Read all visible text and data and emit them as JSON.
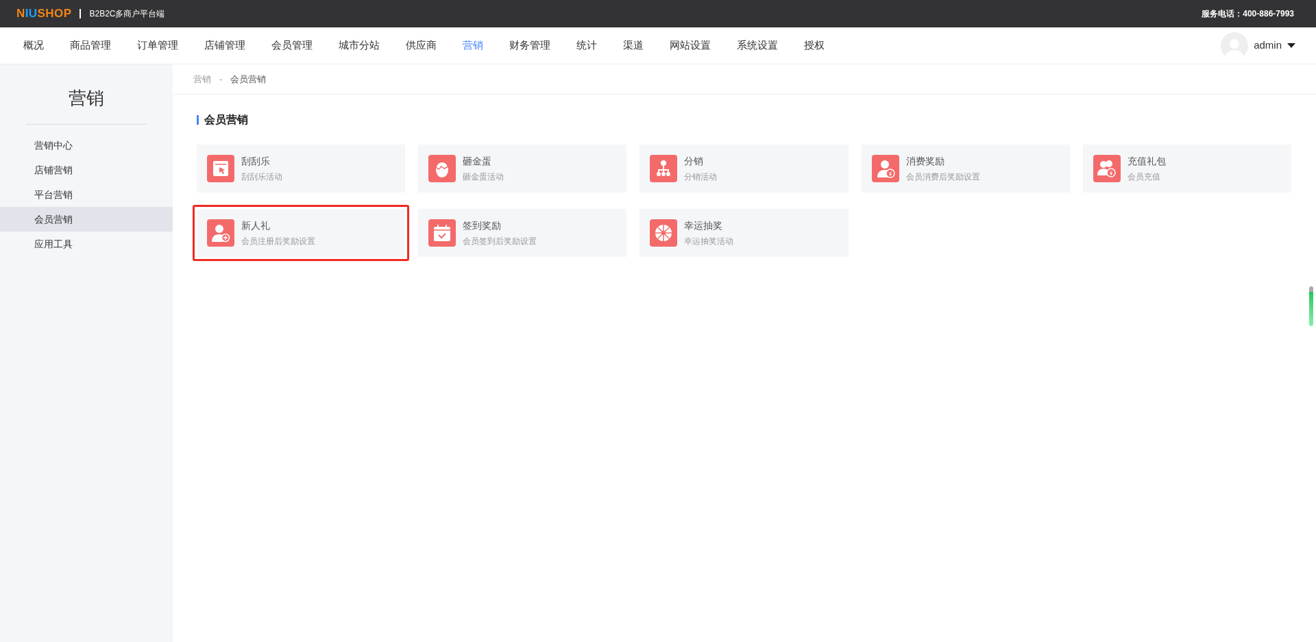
{
  "topbar": {
    "logo": [
      {
        "text": "N",
        "color": "#f08519"
      },
      {
        "text": "IU",
        "color": "#1e9fff"
      },
      {
        "text": "SHOP",
        "color": "#f08519"
      }
    ],
    "subtitle": "B2B2C多商户平台端",
    "service": "服务电话：400-886-7993"
  },
  "nav": {
    "items": [
      {
        "label": "概况",
        "selected": false
      },
      {
        "label": "商品管理",
        "selected": false
      },
      {
        "label": "订单管理",
        "selected": false
      },
      {
        "label": "店铺管理",
        "selected": false
      },
      {
        "label": "会员管理",
        "selected": false
      },
      {
        "label": "城市分站",
        "selected": false
      },
      {
        "label": "供应商",
        "selected": false
      },
      {
        "label": "营销",
        "selected": true
      },
      {
        "label": "财务管理",
        "selected": false
      },
      {
        "label": "统计",
        "selected": false
      },
      {
        "label": "渠道",
        "selected": false
      },
      {
        "label": "网站设置",
        "selected": false
      },
      {
        "label": "系统设置",
        "selected": false
      },
      {
        "label": "授权",
        "selected": false
      }
    ],
    "user": "admin"
  },
  "sidebar": {
    "title": "营销",
    "items": [
      {
        "label": "营销中心",
        "selected": false
      },
      {
        "label": "店铺营销",
        "selected": false
      },
      {
        "label": "平台营销",
        "selected": false
      },
      {
        "label": "会员营销",
        "selected": true
      },
      {
        "label": "应用工具",
        "selected": false
      }
    ]
  },
  "breadcrumb": [
    "营销",
    "-",
    "会员营销"
  ],
  "section_title": "会员营销",
  "cards": [
    {
      "kind": "scratch",
      "title": "刮刮乐",
      "desc": "刮刮乐活动",
      "highlighted": false
    },
    {
      "kind": "egg",
      "title": "砸金蛋",
      "desc": "砸金蛋活动",
      "highlighted": false
    },
    {
      "kind": "tree",
      "title": "分销",
      "desc": "分销活动",
      "highlighted": false
    },
    {
      "kind": "user-coin",
      "title": "消费奖励",
      "desc": "会员消费后奖励设置",
      "highlighted": false
    },
    {
      "kind": "users-coin",
      "title": "充值礼包",
      "desc": "会员充值",
      "highlighted": false
    },
    {
      "kind": "user-plus",
      "title": "新人礼",
      "desc": "会员注册后奖励设置",
      "highlighted": true
    },
    {
      "kind": "calendar",
      "title": "签到奖励",
      "desc": "会员签到后奖励设置",
      "highlighted": false
    },
    {
      "kind": "wheel",
      "title": "幸运抽奖",
      "desc": "幸运抽奖活动",
      "highlighted": false
    }
  ]
}
